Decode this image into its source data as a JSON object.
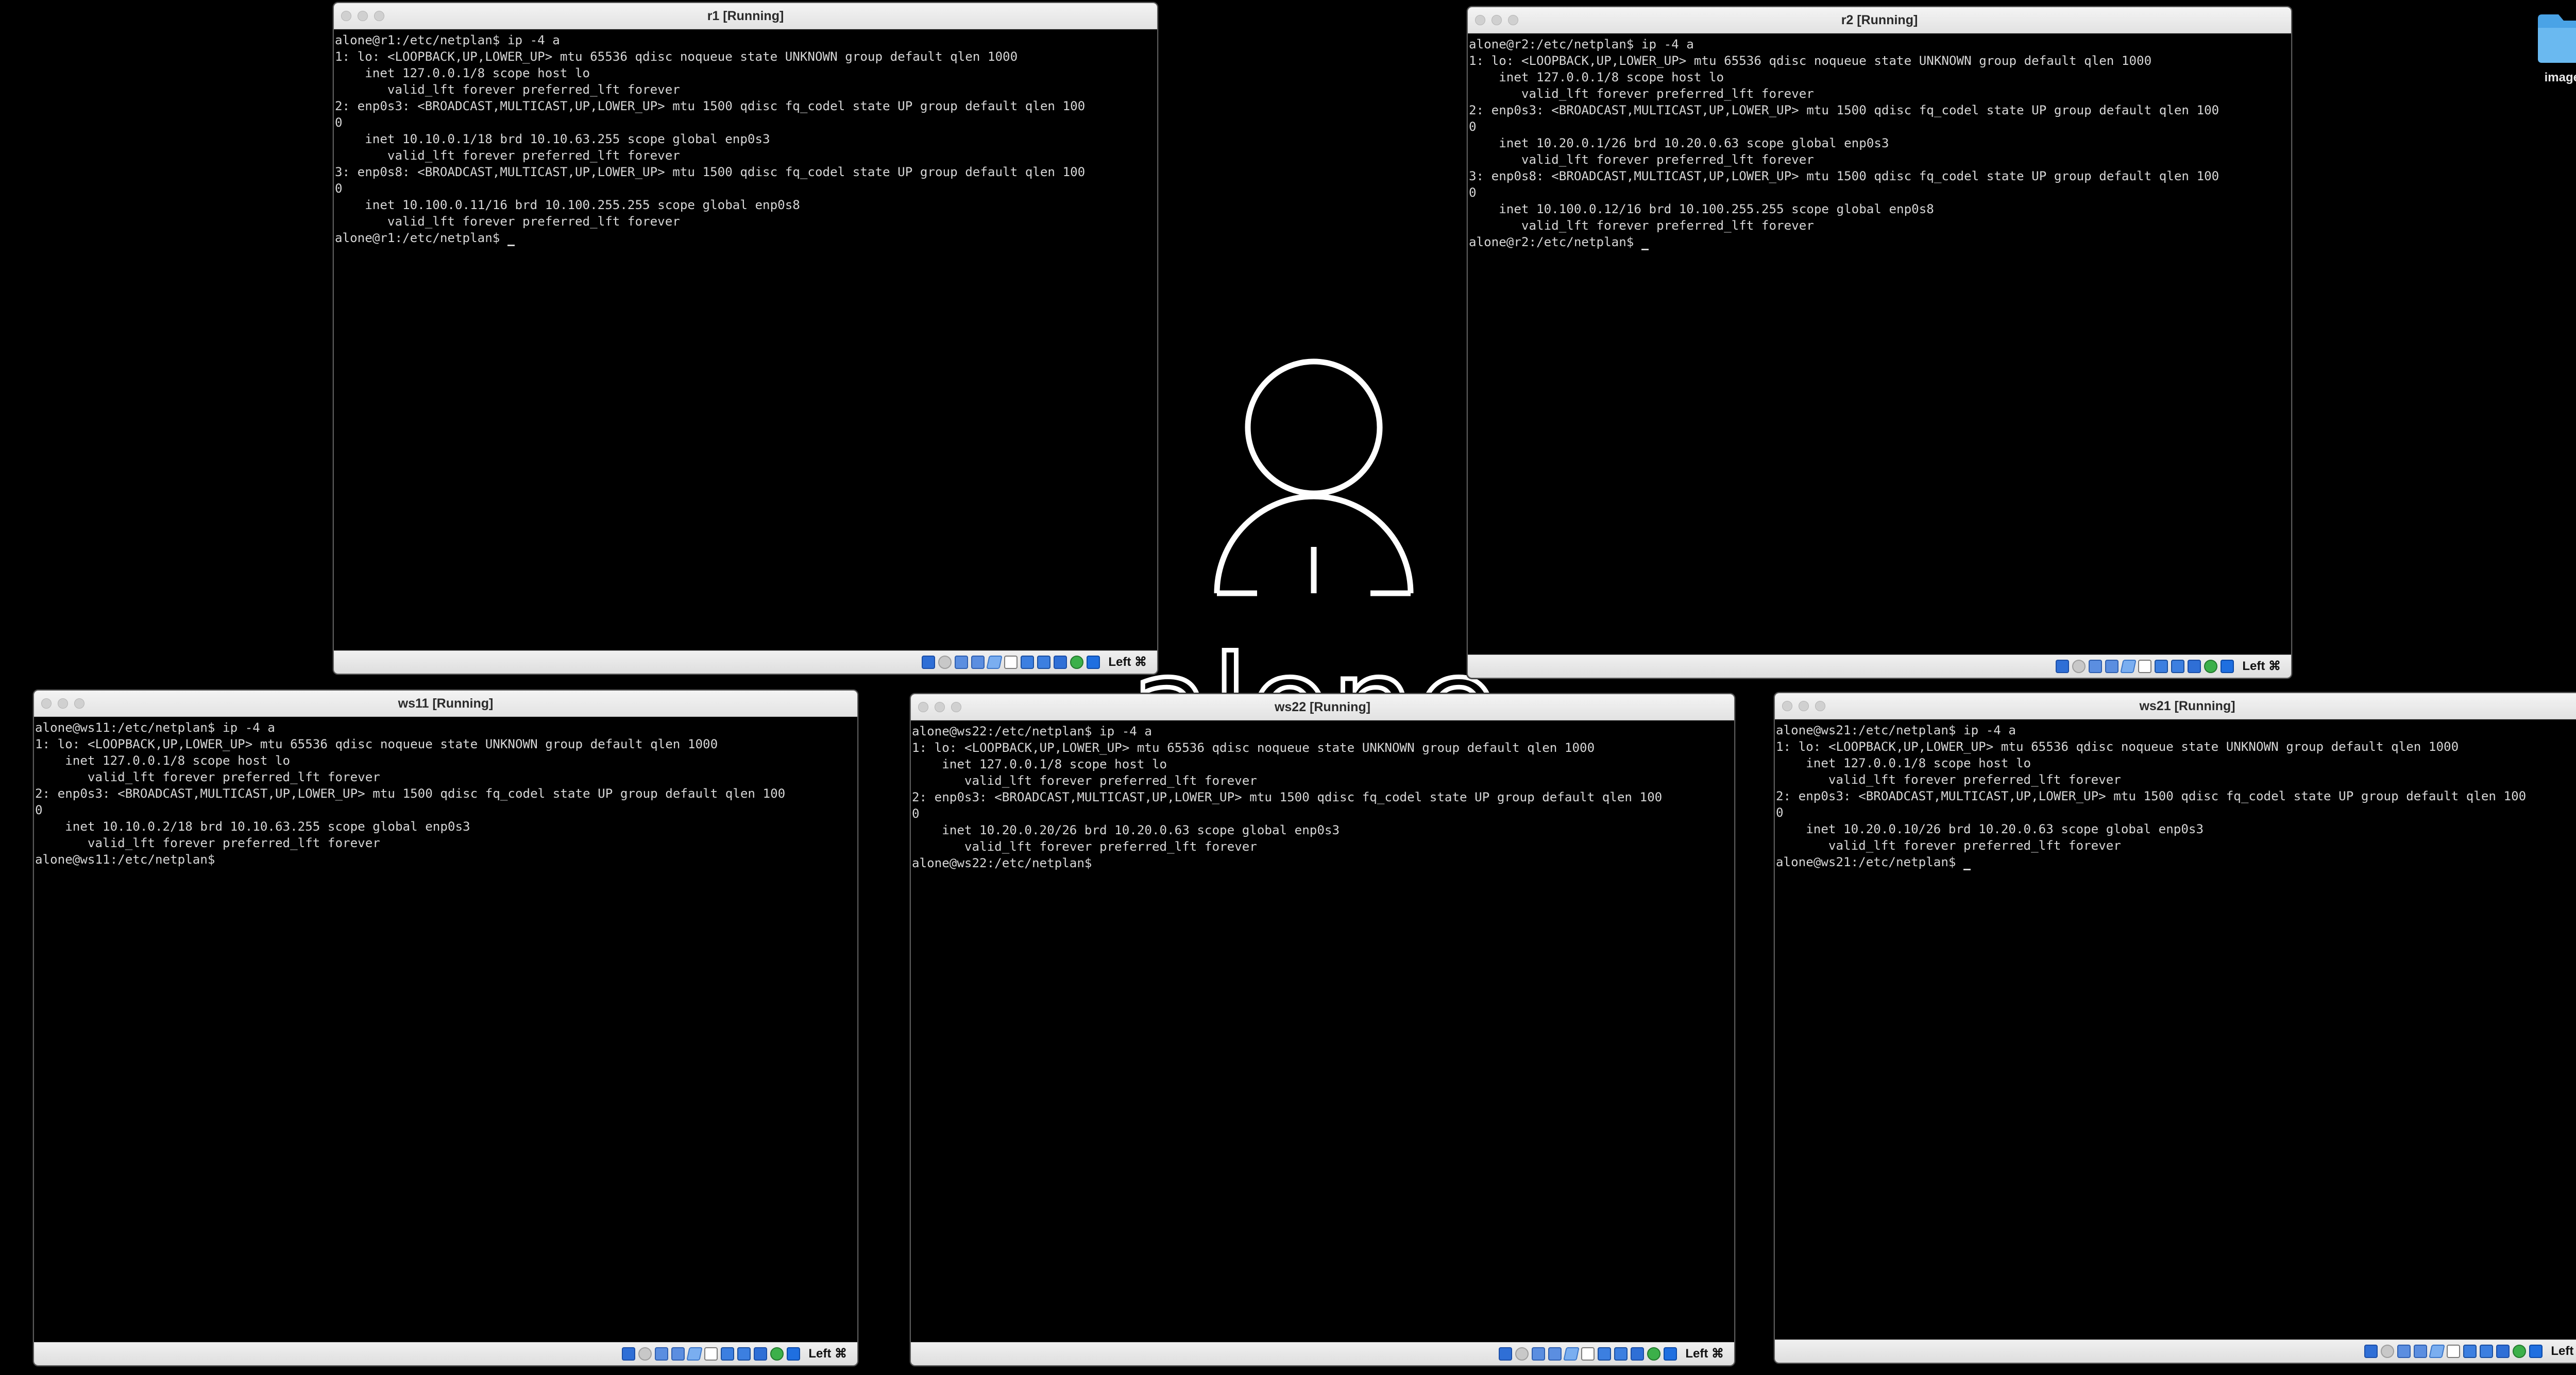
{
  "desktop": {
    "folder_label": "images",
    "wordmark": "alone"
  },
  "hostkey_label": "Left ⌘",
  "windows": {
    "r1": {
      "title": "r1 [Running]",
      "lines": [
        "alone@r1:/etc/netplan$ ip -4 a",
        "1: lo: <LOOPBACK,UP,LOWER_UP> mtu 65536 qdisc noqueue state UNKNOWN group default qlen 1000",
        "    inet 127.0.0.1/8 scope host lo",
        "       valid_lft forever preferred_lft forever",
        "2: enp0s3: <BROADCAST,MULTICAST,UP,LOWER_UP> mtu 1500 qdisc fq_codel state UP group default qlen 100",
        "0",
        "    inet 10.10.0.1/18 brd 10.10.63.255 scope global enp0s3",
        "       valid_lft forever preferred_lft forever",
        "3: enp0s8: <BROADCAST,MULTICAST,UP,LOWER_UP> mtu 1500 qdisc fq_codel state UP group default qlen 100",
        "0",
        "    inet 10.100.0.11/16 brd 10.100.255.255 scope global enp0s8",
        "       valid_lft forever preferred_lft forever",
        "alone@r1:/etc/netplan$ "
      ]
    },
    "r2": {
      "title": "r2 [Running]",
      "lines": [
        "alone@r2:/etc/netplan$ ip -4 a",
        "1: lo: <LOOPBACK,UP,LOWER_UP> mtu 65536 qdisc noqueue state UNKNOWN group default qlen 1000",
        "    inet 127.0.0.1/8 scope host lo",
        "       valid_lft forever preferred_lft forever",
        "2: enp0s3: <BROADCAST,MULTICAST,UP,LOWER_UP> mtu 1500 qdisc fq_codel state UP group default qlen 100",
        "0",
        "    inet 10.20.0.1/26 brd 10.20.0.63 scope global enp0s3",
        "       valid_lft forever preferred_lft forever",
        "3: enp0s8: <BROADCAST,MULTICAST,UP,LOWER_UP> mtu 1500 qdisc fq_codel state UP group default qlen 100",
        "0",
        "    inet 10.100.0.12/16 brd 10.100.255.255 scope global enp0s8",
        "       valid_lft forever preferred_lft forever",
        "alone@r2:/etc/netplan$ "
      ]
    },
    "ws11": {
      "title": "ws11 [Running]",
      "lines": [
        "alone@ws11:/etc/netplan$ ip -4 a",
        "1: lo: <LOOPBACK,UP,LOWER_UP> mtu 65536 qdisc noqueue state UNKNOWN group default qlen 1000",
        "    inet 127.0.0.1/8 scope host lo",
        "       valid_lft forever preferred_lft forever",
        "2: enp0s3: <BROADCAST,MULTICAST,UP,LOWER_UP> mtu 1500 qdisc fq_codel state UP group default qlen 100",
        "0",
        "    inet 10.10.0.2/18 brd 10.10.63.255 scope global enp0s3",
        "       valid_lft forever preferred_lft forever",
        "alone@ws11:/etc/netplan$"
      ]
    },
    "ws22": {
      "title": "ws22 [Running]",
      "lines": [
        "alone@ws22:/etc/netplan$ ip -4 a",
        "1: lo: <LOOPBACK,UP,LOWER_UP> mtu 65536 qdisc noqueue state UNKNOWN group default qlen 1000",
        "    inet 127.0.0.1/8 scope host lo",
        "       valid_lft forever preferred_lft forever",
        "2: enp0s3: <BROADCAST,MULTICAST,UP,LOWER_UP> mtu 1500 qdisc fq_codel state UP group default qlen 100",
        "0",
        "    inet 10.20.0.20/26 brd 10.20.0.63 scope global enp0s3",
        "       valid_lft forever preferred_lft forever",
        "alone@ws22:/etc/netplan$"
      ]
    },
    "ws21": {
      "title": "ws21 [Running]",
      "lines": [
        "alone@ws21:/etc/netplan$ ip -4 a",
        "1: lo: <LOOPBACK,UP,LOWER_UP> mtu 65536 qdisc noqueue state UNKNOWN group default qlen 1000",
        "    inet 127.0.0.1/8 scope host lo",
        "       valid_lft forever preferred_lft forever",
        "2: enp0s3: <BROADCAST,MULTICAST,UP,LOWER_UP> mtu 1500 qdisc fq_codel state UP group default qlen 100",
        "0",
        "    inet 10.20.0.10/26 brd 10.20.0.63 scope global enp0s3",
        "       valid_lft forever preferred_lft forever",
        "alone@ws21:/etc/netplan$ "
      ]
    }
  }
}
